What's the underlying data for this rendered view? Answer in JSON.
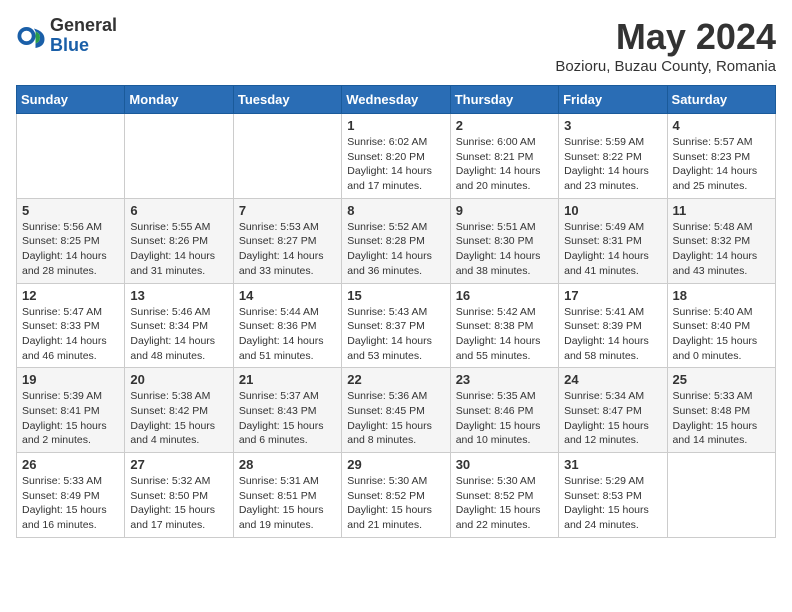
{
  "header": {
    "logo_general": "General",
    "logo_blue": "Blue",
    "month_title": "May 2024",
    "location": "Bozioru, Buzau County, Romania"
  },
  "weekdays": [
    "Sunday",
    "Monday",
    "Tuesday",
    "Wednesday",
    "Thursday",
    "Friday",
    "Saturday"
  ],
  "weeks": [
    [
      {
        "day": "",
        "info": ""
      },
      {
        "day": "",
        "info": ""
      },
      {
        "day": "",
        "info": ""
      },
      {
        "day": "1",
        "info": "Sunrise: 6:02 AM\nSunset: 8:20 PM\nDaylight: 14 hours\nand 17 minutes."
      },
      {
        "day": "2",
        "info": "Sunrise: 6:00 AM\nSunset: 8:21 PM\nDaylight: 14 hours\nand 20 minutes."
      },
      {
        "day": "3",
        "info": "Sunrise: 5:59 AM\nSunset: 8:22 PM\nDaylight: 14 hours\nand 23 minutes."
      },
      {
        "day": "4",
        "info": "Sunrise: 5:57 AM\nSunset: 8:23 PM\nDaylight: 14 hours\nand 25 minutes."
      }
    ],
    [
      {
        "day": "5",
        "info": "Sunrise: 5:56 AM\nSunset: 8:25 PM\nDaylight: 14 hours\nand 28 minutes."
      },
      {
        "day": "6",
        "info": "Sunrise: 5:55 AM\nSunset: 8:26 PM\nDaylight: 14 hours\nand 31 minutes."
      },
      {
        "day": "7",
        "info": "Sunrise: 5:53 AM\nSunset: 8:27 PM\nDaylight: 14 hours\nand 33 minutes."
      },
      {
        "day": "8",
        "info": "Sunrise: 5:52 AM\nSunset: 8:28 PM\nDaylight: 14 hours\nand 36 minutes."
      },
      {
        "day": "9",
        "info": "Sunrise: 5:51 AM\nSunset: 8:30 PM\nDaylight: 14 hours\nand 38 minutes."
      },
      {
        "day": "10",
        "info": "Sunrise: 5:49 AM\nSunset: 8:31 PM\nDaylight: 14 hours\nand 41 minutes."
      },
      {
        "day": "11",
        "info": "Sunrise: 5:48 AM\nSunset: 8:32 PM\nDaylight: 14 hours\nand 43 minutes."
      }
    ],
    [
      {
        "day": "12",
        "info": "Sunrise: 5:47 AM\nSunset: 8:33 PM\nDaylight: 14 hours\nand 46 minutes."
      },
      {
        "day": "13",
        "info": "Sunrise: 5:46 AM\nSunset: 8:34 PM\nDaylight: 14 hours\nand 48 minutes."
      },
      {
        "day": "14",
        "info": "Sunrise: 5:44 AM\nSunset: 8:36 PM\nDaylight: 14 hours\nand 51 minutes."
      },
      {
        "day": "15",
        "info": "Sunrise: 5:43 AM\nSunset: 8:37 PM\nDaylight: 14 hours\nand 53 minutes."
      },
      {
        "day": "16",
        "info": "Sunrise: 5:42 AM\nSunset: 8:38 PM\nDaylight: 14 hours\nand 55 minutes."
      },
      {
        "day": "17",
        "info": "Sunrise: 5:41 AM\nSunset: 8:39 PM\nDaylight: 14 hours\nand 58 minutes."
      },
      {
        "day": "18",
        "info": "Sunrise: 5:40 AM\nSunset: 8:40 PM\nDaylight: 15 hours\nand 0 minutes."
      }
    ],
    [
      {
        "day": "19",
        "info": "Sunrise: 5:39 AM\nSunset: 8:41 PM\nDaylight: 15 hours\nand 2 minutes."
      },
      {
        "day": "20",
        "info": "Sunrise: 5:38 AM\nSunset: 8:42 PM\nDaylight: 15 hours\nand 4 minutes."
      },
      {
        "day": "21",
        "info": "Sunrise: 5:37 AM\nSunset: 8:43 PM\nDaylight: 15 hours\nand 6 minutes."
      },
      {
        "day": "22",
        "info": "Sunrise: 5:36 AM\nSunset: 8:45 PM\nDaylight: 15 hours\nand 8 minutes."
      },
      {
        "day": "23",
        "info": "Sunrise: 5:35 AM\nSunset: 8:46 PM\nDaylight: 15 hours\nand 10 minutes."
      },
      {
        "day": "24",
        "info": "Sunrise: 5:34 AM\nSunset: 8:47 PM\nDaylight: 15 hours\nand 12 minutes."
      },
      {
        "day": "25",
        "info": "Sunrise: 5:33 AM\nSunset: 8:48 PM\nDaylight: 15 hours\nand 14 minutes."
      }
    ],
    [
      {
        "day": "26",
        "info": "Sunrise: 5:33 AM\nSunset: 8:49 PM\nDaylight: 15 hours\nand 16 minutes."
      },
      {
        "day": "27",
        "info": "Sunrise: 5:32 AM\nSunset: 8:50 PM\nDaylight: 15 hours\nand 17 minutes."
      },
      {
        "day": "28",
        "info": "Sunrise: 5:31 AM\nSunset: 8:51 PM\nDaylight: 15 hours\nand 19 minutes."
      },
      {
        "day": "29",
        "info": "Sunrise: 5:30 AM\nSunset: 8:52 PM\nDaylight: 15 hours\nand 21 minutes."
      },
      {
        "day": "30",
        "info": "Sunrise: 5:30 AM\nSunset: 8:52 PM\nDaylight: 15 hours\nand 22 minutes."
      },
      {
        "day": "31",
        "info": "Sunrise: 5:29 AM\nSunset: 8:53 PM\nDaylight: 15 hours\nand 24 minutes."
      },
      {
        "day": "",
        "info": ""
      }
    ]
  ]
}
